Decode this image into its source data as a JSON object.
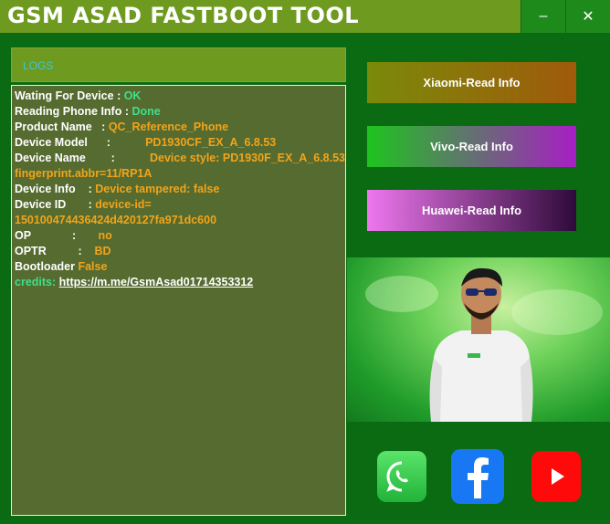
{
  "window": {
    "title": "GSM ASAD FASTBOOT TOOL",
    "minimize_glyph": "–",
    "close_glyph": "✕"
  },
  "log": {
    "header_label": "LOGS",
    "lines": [
      {
        "key": "Wating For Device",
        "sep": " : ",
        "value": "OK"
      },
      {
        "key": "Reading Phone Info",
        "sep": " : ",
        "value": "Done"
      },
      {
        "key": "Product Name",
        "sep": "   : ",
        "value": "QC_Reference_Phone"
      },
      {
        "key": "Device Model",
        "sep": "      :           ",
        "value": "PD1930CF_EX_A_6.8.53"
      },
      {
        "key": "Device Name",
        "sep": "        :           ",
        "value": "Device style: PD1930F_EX_A_6.8.53"
      },
      {
        "key": "",
        "sep": "",
        "value": "fingerprint.abbr=11/RP1A"
      },
      {
        "key": "Device Info",
        "sep": "    : ",
        "value": "Device tampered: false"
      },
      {
        "key": "Device ID",
        "sep": "       : ",
        "value": "device-id="
      },
      {
        "key": "",
        "sep": "",
        "value": "150100474436424d420127fa971dc600"
      },
      {
        "key": "OP",
        "sep": "             :       ",
        "value": "no"
      },
      {
        "key": "OPTR",
        "sep": "          :    ",
        "value": "BD"
      },
      {
        "key": "Bootloader",
        "sep": " ",
        "value": "False"
      }
    ],
    "credits_label": "credits:",
    "credits_link": "https://m.me/GsmAsad01714353312"
  },
  "buttons": {
    "xiaomi": "Xiaomi-Read Info",
    "vivo": "Vivo-Read Info",
    "huawei": "Huawei-Read Info"
  },
  "social": {
    "whatsapp_icon": "whatsapp-icon",
    "facebook_icon": "facebook-icon",
    "youtube_icon": "youtube-icon"
  },
  "colors": {
    "background": "#0b6b12",
    "title_bar": "#6d9a1f",
    "log_bg": "#556b2f",
    "value_ok": "#3ee08a",
    "value_info": "#f2a41a"
  }
}
